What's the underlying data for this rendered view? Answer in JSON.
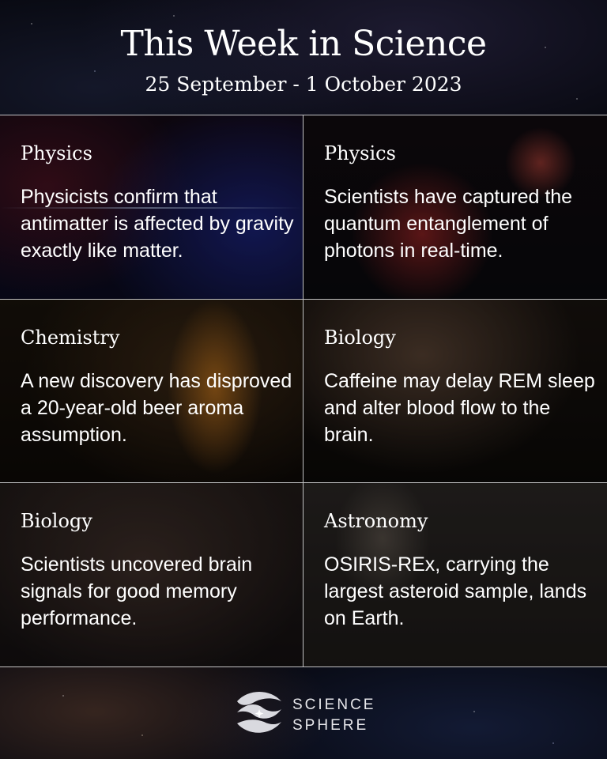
{
  "header": {
    "title": "This Week in Science",
    "subtitle": "25 September - 1 October 2023"
  },
  "cards": [
    {
      "category": "Physics",
      "headline": "Physicists confirm that antimatter is affected by gravity exactly like matter."
    },
    {
      "category": "Physics",
      "headline": "Scientists have captured the quantum entanglement of photons in real-time."
    },
    {
      "category": "Chemistry",
      "headline": "A new discovery has disproved a 20-year-old beer aroma assumption."
    },
    {
      "category": "Biology",
      "headline": "Caffeine may delay REM sleep and alter blood flow to the brain."
    },
    {
      "category": "Biology",
      "headline": "Scientists uncovered brain signals for good memory performance."
    },
    {
      "category": "Astronomy",
      "headline": "OSIRIS-REx, carrying the largest asteroid sample, lands on Earth."
    }
  ],
  "footer": {
    "brand_line1": "SCIENCE",
    "brand_line2": "SPHERE",
    "logo_icon": "sphere-wave-logo"
  }
}
